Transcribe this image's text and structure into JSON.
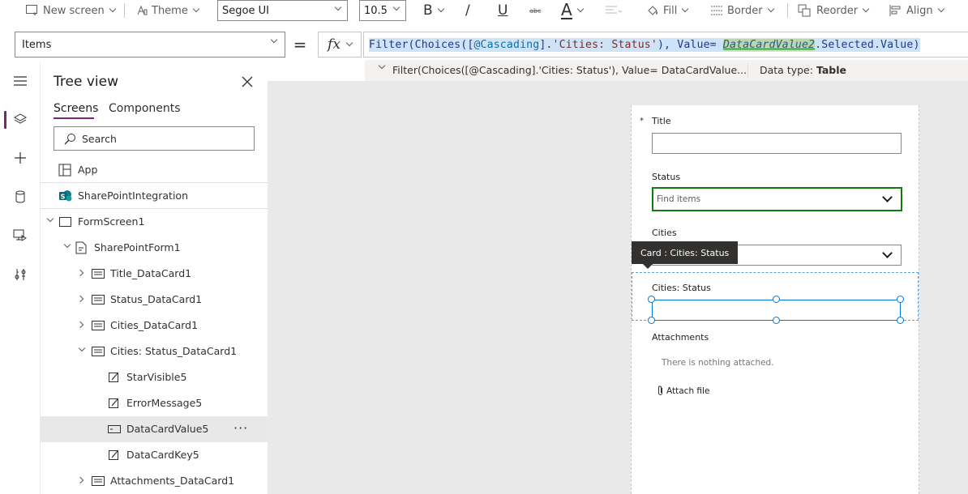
{
  "toolbar": {
    "new_screen": "New screen",
    "theme": "Theme",
    "font_family": "Segoe UI",
    "font_size": "10.5",
    "bold": "B",
    "italic": "/",
    "underline": "U",
    "strikethrough": "abc",
    "font_color": "A",
    "fill": "Fill",
    "border": "Border",
    "reorder": "Reorder",
    "align": "Align"
  },
  "formula_bar": {
    "property": "Items",
    "equals": "=",
    "fx": "fx",
    "formula": {
      "p1": "Filter(Choices([",
      "p2": "@Cascading",
      "p3": "].",
      "p4": "'Cities: Status'",
      "p5": "), Value= ",
      "p6": "DataCardValue2",
      "p7": ".Selected.Value)"
    },
    "hint_text": "Filter(Choices([@Cascading].'Cities: Status'), Value= DataCardValue...",
    "data_type_label": "Data type:",
    "data_type_value": "Table"
  },
  "tree_view": {
    "title": "Tree view",
    "tabs": [
      "Screens",
      "Components"
    ],
    "search_placeholder": "Search",
    "items": [
      {
        "label": "App"
      },
      {
        "label": "SharePointIntegration"
      },
      {
        "label": "FormScreen1"
      },
      {
        "label": "SharePointForm1"
      },
      {
        "label": "Title_DataCard1"
      },
      {
        "label": "Status_DataCard1"
      },
      {
        "label": "Cities_DataCard1"
      },
      {
        "label": "Cities: Status_DataCard1"
      },
      {
        "label": "StarVisible5"
      },
      {
        "label": "ErrorMessage5"
      },
      {
        "label": "DataCardValue5"
      },
      {
        "label": "DataCardKey5"
      },
      {
        "label": "Attachments_DataCard1"
      }
    ],
    "more_actions": "···"
  },
  "form": {
    "required_marker": "*",
    "title_label": "Title",
    "status_label": "Status",
    "status_placeholder": "Find items",
    "cities_label": "Cities",
    "tooltip": "Card : Cities: Status",
    "cities_status_label": "Cities: Status",
    "attachments_label": "Attachments",
    "nothing_attached": "There is nothing attached.",
    "attach_file": "Attach file"
  },
  "colors": {
    "accent": "#742774",
    "selection": "#0078d4",
    "focus_green": "#107c10",
    "canvas_bg": "#e9e9e9"
  }
}
